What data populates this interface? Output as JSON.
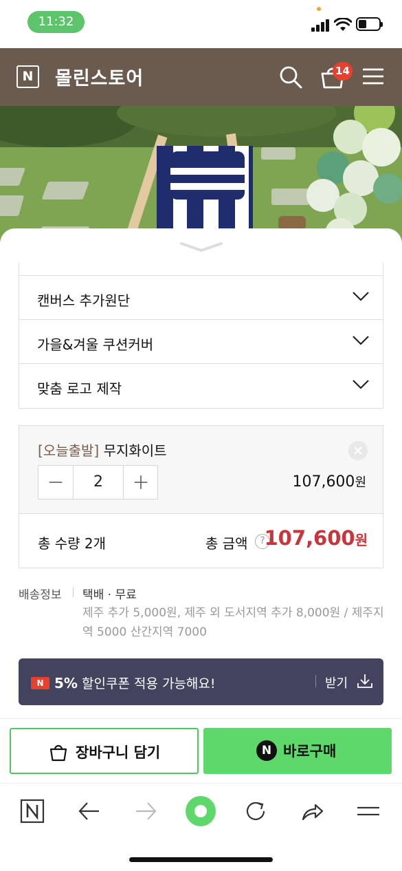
{
  "status_bar": {
    "time": "11:32",
    "battery_level": 0.4
  },
  "header": {
    "logo_letter": "N",
    "store_name": "몰린스토어",
    "cart_count": "14",
    "background_color": "#6b5a4e"
  },
  "options": [
    {
      "label": "캔버스 추가원단"
    },
    {
      "label": "가을&겨울 쿠션커버"
    },
    {
      "label": "맞춤 로고 제작"
    }
  ],
  "selected_item": {
    "tag": "[오늘출발]",
    "name": "무지화이트",
    "quantity": "2",
    "price": "107,600",
    "currency": "원"
  },
  "totals": {
    "qty_label": "총 수량",
    "qty_value": "2개",
    "amount_label": "총 금액",
    "help": "?",
    "amount": "107,600",
    "currency": "원",
    "accent_color": "#c8363c"
  },
  "shipping": {
    "label": "배송정보",
    "method": "택배 · 무료",
    "extra": "제주 추가 5,000원, 제주 외 도서지역 추가 8,000원 / 제주지역 5000 산간지역 7000"
  },
  "coupon": {
    "badge": "N",
    "percent": "5%",
    "text": " 할인쿠폰 적용 가능해요!",
    "action": "받기"
  },
  "actions": {
    "cart_label": "장바구니 담기",
    "buy_badge": "N",
    "buy_label": "바로구매",
    "buy_color": "#5fd86b"
  },
  "browser_toolbar": {
    "items": [
      "home-icon",
      "back-icon",
      "forward-icon",
      "green-dot-icon",
      "reload-icon",
      "share-icon",
      "menu-icon"
    ]
  }
}
